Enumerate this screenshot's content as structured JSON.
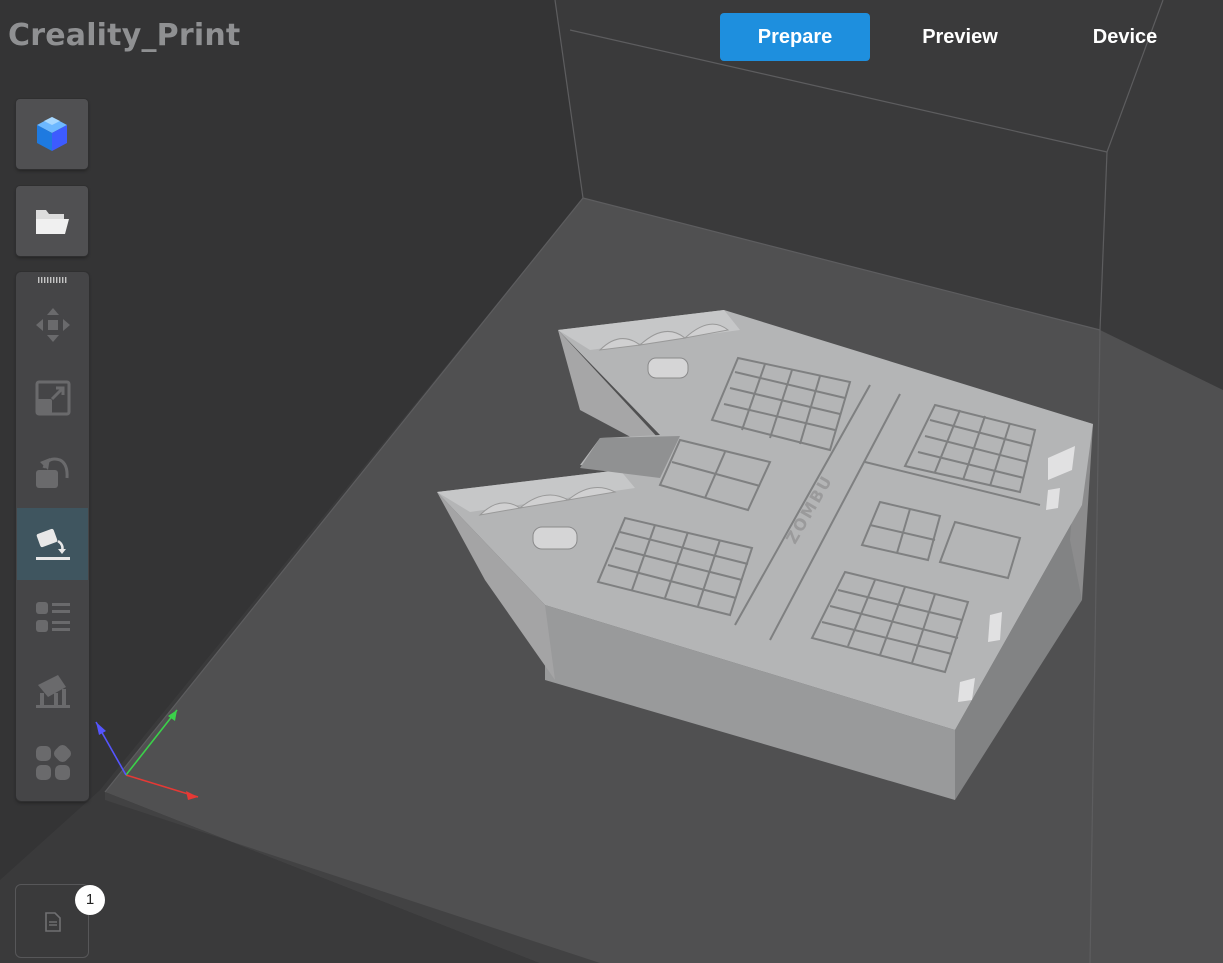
{
  "app": {
    "title": "Creality_Print"
  },
  "tabs": [
    {
      "label": "Prepare",
      "active": true
    },
    {
      "label": "Preview",
      "active": false
    },
    {
      "label": "Device",
      "active": false
    }
  ],
  "sidebar": {
    "top_buttons": [
      {
        "icon": "model-library-icon"
      },
      {
        "icon": "open-folder-icon"
      }
    ],
    "tools": [
      {
        "icon": "move-icon",
        "active": false
      },
      {
        "icon": "scale-icon",
        "active": false
      },
      {
        "icon": "rotate-icon",
        "active": false
      },
      {
        "icon": "lay-on-face-icon",
        "active": true
      },
      {
        "icon": "object-list-icon",
        "active": false
      },
      {
        "icon": "support-icon",
        "active": false
      },
      {
        "icon": "arrange-icon",
        "active": false
      }
    ]
  },
  "gcode_list": {
    "icon": "document-icon",
    "count": "1"
  },
  "model": {
    "engraved_text": "ZOMBU"
  },
  "colors": {
    "accent": "#1e8fde",
    "background": "#3a3a3b",
    "axis_x": "#e53935",
    "axis_y": "#3bd14a",
    "axis_z": "#5555ff"
  }
}
